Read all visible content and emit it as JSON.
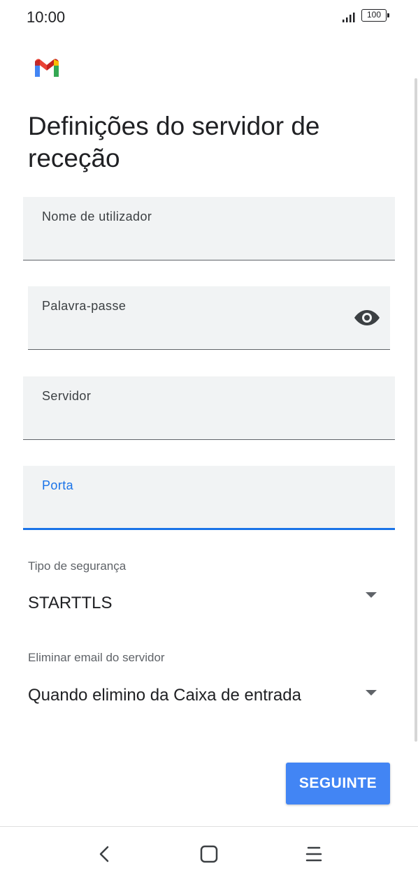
{
  "status_bar": {
    "time": "10:00",
    "signal_icon": "signal-bars-icon",
    "battery_level": "100"
  },
  "app": {
    "logo_icon": "gmail-logo-icon"
  },
  "page": {
    "title": "Definições do servidor de receção"
  },
  "form": {
    "username": {
      "label": "Nome de utilizador",
      "value": ""
    },
    "password": {
      "label": "Palavra-passe",
      "value": "",
      "toggle_icon": "eye-icon"
    },
    "server": {
      "label": "Servidor",
      "value": ""
    },
    "port": {
      "label": "Porta",
      "value": "",
      "focused": true
    },
    "security_type": {
      "label": "Tipo de segurança",
      "selected": "STARTTLS",
      "icon": "dropdown-arrow-icon"
    },
    "delete_email": {
      "label": "Eliminar email do servidor",
      "selected": "Quando elimino da Caixa de entrada",
      "icon": "dropdown-arrow-icon"
    }
  },
  "actions": {
    "next_label": "SEGUINTE"
  },
  "nav": {
    "back_icon": "back-chevron-icon",
    "home_icon": "home-square-icon",
    "menu_icon": "menu-lines-icon"
  },
  "colors": {
    "accent": "#1a73e8",
    "button": "#4285f4",
    "field_bg": "#f1f3f4"
  }
}
